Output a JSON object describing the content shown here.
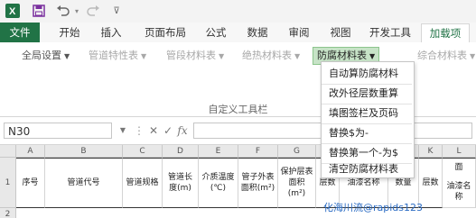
{
  "qat": {
    "icons": [
      "excel-logo-icon",
      "save-icon",
      "undo-icon",
      "redo-icon",
      "customize-qat-icon"
    ]
  },
  "ribbon_tabs": {
    "file": "文件",
    "home": "开始",
    "insert": "插入",
    "page_layout": "页面布局",
    "formulas": "公式",
    "data": "数据",
    "review": "审阅",
    "view": "视图",
    "developer": "开发工具",
    "addins": "加载项"
  },
  "toolbar": {
    "global_settings": "全局设置",
    "pipe_props": "管道特性表",
    "pipe_material": "管段材料表",
    "insulation_material": "绝热材料表",
    "anticorrosion_material": "防腐材料表",
    "combined_material": "综合材料表",
    "group_label": "自定义工具栏"
  },
  "dropdown": {
    "items": [
      "自动算防腐材料",
      "改外径层数重算",
      "填图签栏及页码",
      "替换$为-",
      "替换第一个-为$",
      "清空防腐材料表"
    ]
  },
  "formula_bar": {
    "name_box": "N30",
    "fx": "fx",
    "cancel": "✕",
    "enter": "✓"
  },
  "grid": {
    "columns": [
      "A",
      "B",
      "C",
      "D",
      "E",
      "F",
      "G",
      "H",
      "I",
      "J",
      "K",
      "L"
    ],
    "rows": [
      "1",
      "2"
    ],
    "headers": {
      "a": "序号",
      "b": "管道代号",
      "c": "管道规格",
      "d": "管道长度(m)",
      "e": "介质温度(℃)",
      "f": "管子外表面积(m²)",
      "g": "保护层表面积(m²)",
      "h": "层数",
      "i": "油漆名称",
      "j": "数量",
      "k": "层数",
      "l": "油漆名称"
    },
    "partial_header_right": "面"
  },
  "watermark": "化海川流@rapids123"
}
